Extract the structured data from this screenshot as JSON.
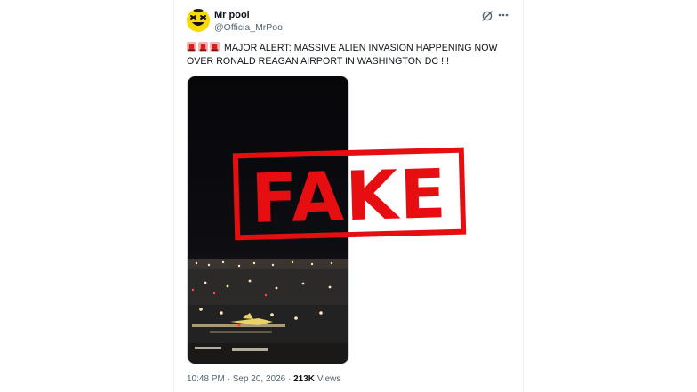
{
  "tweet": {
    "author": {
      "display_name": "Mr pool",
      "handle": "@Officia_MrPoo",
      "avatar_icon": "yellow-smiley-avatar"
    },
    "header_icons": [
      "grok-icon",
      "more-icon"
    ],
    "text_prefix_icons": [
      "siren-icon",
      "siren-icon",
      "siren-icon"
    ],
    "text": "MAJOR ALERT: MASSIVE ALIEN INVASION HAPPENING NOW OVER RONALD REAGAN AIRPORT IN WASHINGTON DC !!!",
    "media": {
      "type": "video",
      "stamp_text": "FAKE",
      "stamp_color": "#e60e10"
    },
    "footer": {
      "time": "10:48 PM",
      "separator": "·",
      "date": "Sep 20, 2026",
      "separator2": "·",
      "views_count": "213K",
      "views_label": "Views"
    }
  },
  "colors": {
    "text_primary": "#0f1419",
    "text_secondary": "#536471",
    "divider": "#eff3f4",
    "stamp_red": "#e60e10"
  }
}
